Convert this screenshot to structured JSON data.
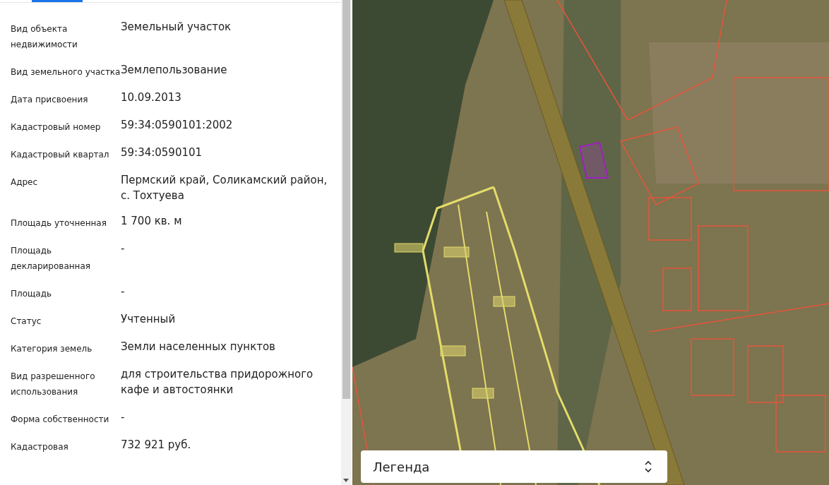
{
  "properties": [
    {
      "label": "Вид объекта недвижимости",
      "value": "Земельный участок"
    },
    {
      "label": "Вид земельного участка",
      "value": "Землепользование"
    },
    {
      "label": "Дата присвоения",
      "value": "10.09.2013"
    },
    {
      "label": "Кадастровый номер",
      "value": "59:34:0590101:2002"
    },
    {
      "label": "Кадастровый квартал",
      "value": "59:34:0590101"
    },
    {
      "label": "Адрес",
      "value": "Пермский край, Соликамский район, с. Тохтуева"
    },
    {
      "label": "Площадь уточненная",
      "value": "1 700 кв. м"
    },
    {
      "label": "Площадь декларированная",
      "value": "-"
    },
    {
      "label": "Площадь",
      "value": "-"
    },
    {
      "label": "Статус",
      "value": "Учтенный"
    },
    {
      "label": "Категория земель",
      "value": "Земли населенных пунктов"
    },
    {
      "label": "Вид разрешенного использования",
      "value": "для строительства придорожного кафе и автостоянки"
    },
    {
      "label": "Форма собственности",
      "value": "-"
    },
    {
      "label": "Кадастровая",
      "value": "732 921 руб."
    }
  ],
  "legend": {
    "label": "Легенда"
  }
}
